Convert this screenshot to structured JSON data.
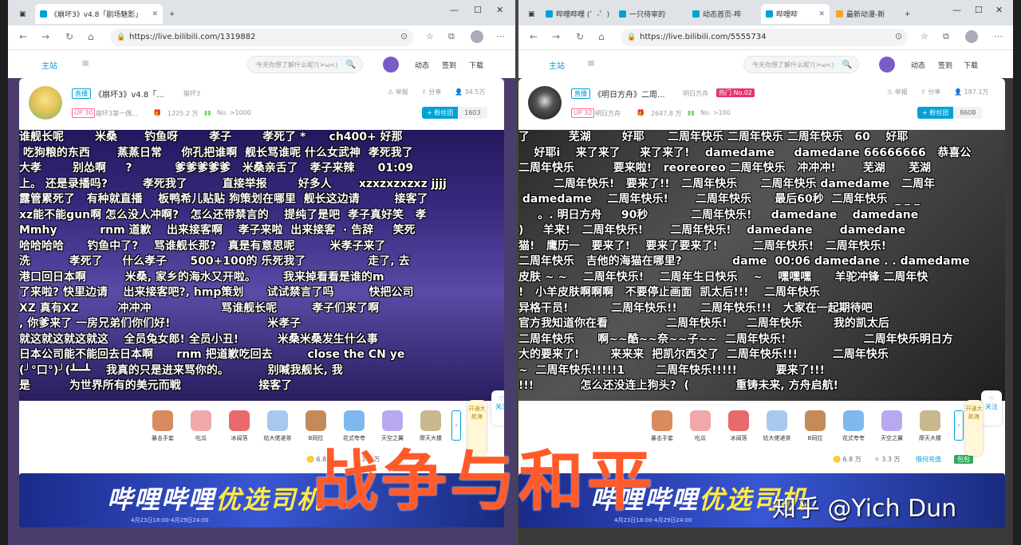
{
  "overlay": {
    "title": "战争与和平",
    "watermark": "知乎 @Yich Dun"
  },
  "left": {
    "tabs": [
      {
        "label": "《崩坏3》v4.8「剧场魅影」"
      }
    ],
    "url": "https://live.bilibili.com/1319882",
    "site": {
      "home": "主站",
      "search_placeholder": "今天你想了解什么呢?(>ω<)",
      "links": [
        "动态",
        "签到",
        "下载"
      ]
    },
    "room": {
      "live_label": "直播",
      "title": "《崩坏3》v4.8「...",
      "area": "崩坏3",
      "report": "举报",
      "share": "分享",
      "viewers": "34.5万",
      "up_level": "UP 30",
      "up_name": "崩坏3第一偶...",
      "gift_count": "1225.2 万",
      "rank": "No. >1000",
      "follow_label": "+ 粉丝团",
      "fans": "1603"
    },
    "danmaku": [
      "谁舰长呢        米桑       钓鱼呀        孝子        孝死了 *      ch400+ 好那",
      " 吃狗粮的东西       蒸蒸日常     你孔把谁啊  舰长骂谁呢 什么女武神  孝死我了",
      "大孝        别怂啊     ?           爹爹爹爹爹   米桑亲舌了   孝子来辣      01:09",
      "上。 还是录播吗?         孝死我了         直接举报        好多人       xzxzxzxzxz jjjj",
      "露管累死了   有种就直播    板鸭希儿贴贴 狗策划在哪里  舰长这边请         接客了",
      "xz能不能gun啊 怎么没人冲啊?   怎么还带禁言的    提纯了是吧  孝子真好笑   孝",
      "Mmhy           rnm 道歉    出来接客啊    孝子来啦  出来接客  · 告辞     笑死",
      "哈哈哈哈      钓鱼中了?    骂谁舰长那?   真是有意思呢         米孝子来了",
      "洗          孝死了     什么孝子      500+100的 乐死我了                走了, 去",
      "港口回日本啊          米桑, 家乡的海水又开啦。       我来掉看看是谁的m",
      "了来啦? 快里边请    出来接客吧?, hmp策划      试试禁言了吗         快把公司",
      "XZ 真有XZ          冲冲冲                  骂谁舰长呢         孝子们来了啊",
      ", 你爹来了 一房兄弟们你们好!                         米孝子",
      "就这就这就这就这    全员兔女郎! 全员小丑!          米桑米桑发生什么事",
      "日本公司能不能回去日本啊      rnm 把道歉吃回去         close the CN ye",
      "(╯°口°)╯(┻━┻    我真的只是进来骂你的。          别喊我舰长, 我",
      "是          为世界所有的美元而戦                    接客了"
    ],
    "gifts": [
      {
        "name": "暴击手套"
      },
      {
        "name": "吃瓜"
      },
      {
        "name": "冰阔落"
      },
      {
        "name": "给大佬递茶"
      },
      {
        "name": "B同拉"
      },
      {
        "name": "花式夸夸"
      },
      {
        "name": "天空之翼"
      },
      {
        "name": "摩天大楼"
      }
    ],
    "stats": {
      "gold": "6.8 万",
      "silver": "3.3 万"
    },
    "side": {
      "follow": "关注",
      "vip": "开通大航海"
    },
    "banner": {
      "text_a": "哔哩哔哩",
      "text_b": "优选司机",
      "date": "4月23日18:00-4月29日24:00"
    }
  },
  "right": {
    "tabs": [
      {
        "label": "哔哩哔哩 (゜-゜)"
      },
      {
        "label": "一只待宰的"
      },
      {
        "label": "动态首页-哔"
      },
      {
        "label": "哔哩哔"
      },
      {
        "label": "最新动漫-新"
      }
    ],
    "url": "https://live.bilibili.com/5555734",
    "site": {
      "home": "主站",
      "search_placeholder": "今天你想了解什么呢?(>ω<)",
      "links": [
        "动态",
        "签到",
        "下载"
      ]
    },
    "room": {
      "live_label": "直播",
      "title": "《明日方舟》二周...",
      "area": "明日方舟",
      "hot": "热门 No.02",
      "report": "举报",
      "share": "分享",
      "viewers": "187.1万",
      "up_level": "UP 32",
      "up_name": "明日方舟",
      "gift_count": "2647.8 万",
      "rank": "No. >100",
      "follow_label": "+ 粉丝团",
      "fans": "8608"
    },
    "danmaku": [
      "了          芜湖        好耶      二周年快乐 二周年快乐 二周年快乐   60    好耶",
      "    好耶i    来了来了     来了来了!    damedame     damedane 66666666   恭喜公",
      "二周年快乐          要来啦!   reoreoreo 二周年快乐   冲冲冲!       芜湖      芜湖",
      "         二周年快乐!   要来了!!   二周年快乐      二周年快乐 damedame   二周年",
      " damedame    二周年快乐!       二周年快乐      最后60秒  二周年快乐  _ _ _",
      "     。. 明日方舟     90秒           二周年快乐!     damedane    damedane",
      ")     羊来!   二周年快乐!       二周年快乐!    damedane       damedane",
      "猫!   鹰历一   要来了!    要来了要来了!         二周年快乐!   二周年快乐!",
      "二周年快乐   吉他的海猫在哪里?             dame  00:06 damedane . . damedame",
      "皮肤 ~ ~    二周年快乐!    二周年生日快乐    ~    嘿嘿嘿      羊驼冲锋 二周年快",
      "!   小羊皮肤啊啊啊   不要停止画面  凯太后!!!    二周年快乐",
      "异格干员!           二周年快乐!!      二周年快乐!!!   大家在一起期待吧",
      "官方我知道你在看               二周年快乐!     二周年快乐        我的凯太后",
      "二周年快乐      啊~~酷~~奈~~子~~  二周年快乐!                    二周年快乐明日方",
      "大的要来了!        来来来  把凯尔西交了  二周年快乐!!!         二周年快乐",
      "~  二周年快乐!!!!!1        二周年快乐!!!!!          要来了!!!",
      "!!!            怎么还没连上狗头?  (            重铸未来, 方舟启航!"
    ],
    "gifts": [
      {
        "name": "暴击手套"
      },
      {
        "name": "吃瓜"
      },
      {
        "name": "冰阔落"
      },
      {
        "name": "给大佬递茶"
      },
      {
        "name": "B同拉"
      },
      {
        "name": "花式夸夸"
      },
      {
        "name": "天空之翼"
      },
      {
        "name": "摩天大楼"
      }
    ],
    "stats": {
      "gold": "6.8 万",
      "silver": "3.3 万",
      "recharge": "借何充值",
      "pack": "包包"
    },
    "side": {
      "follow": "关注",
      "vip": "开通大航海"
    },
    "banner": {
      "text_a": "哔哩哔哩",
      "text_b": "优选司机",
      "date": "4月23日18:00-4月29日24:00"
    }
  }
}
